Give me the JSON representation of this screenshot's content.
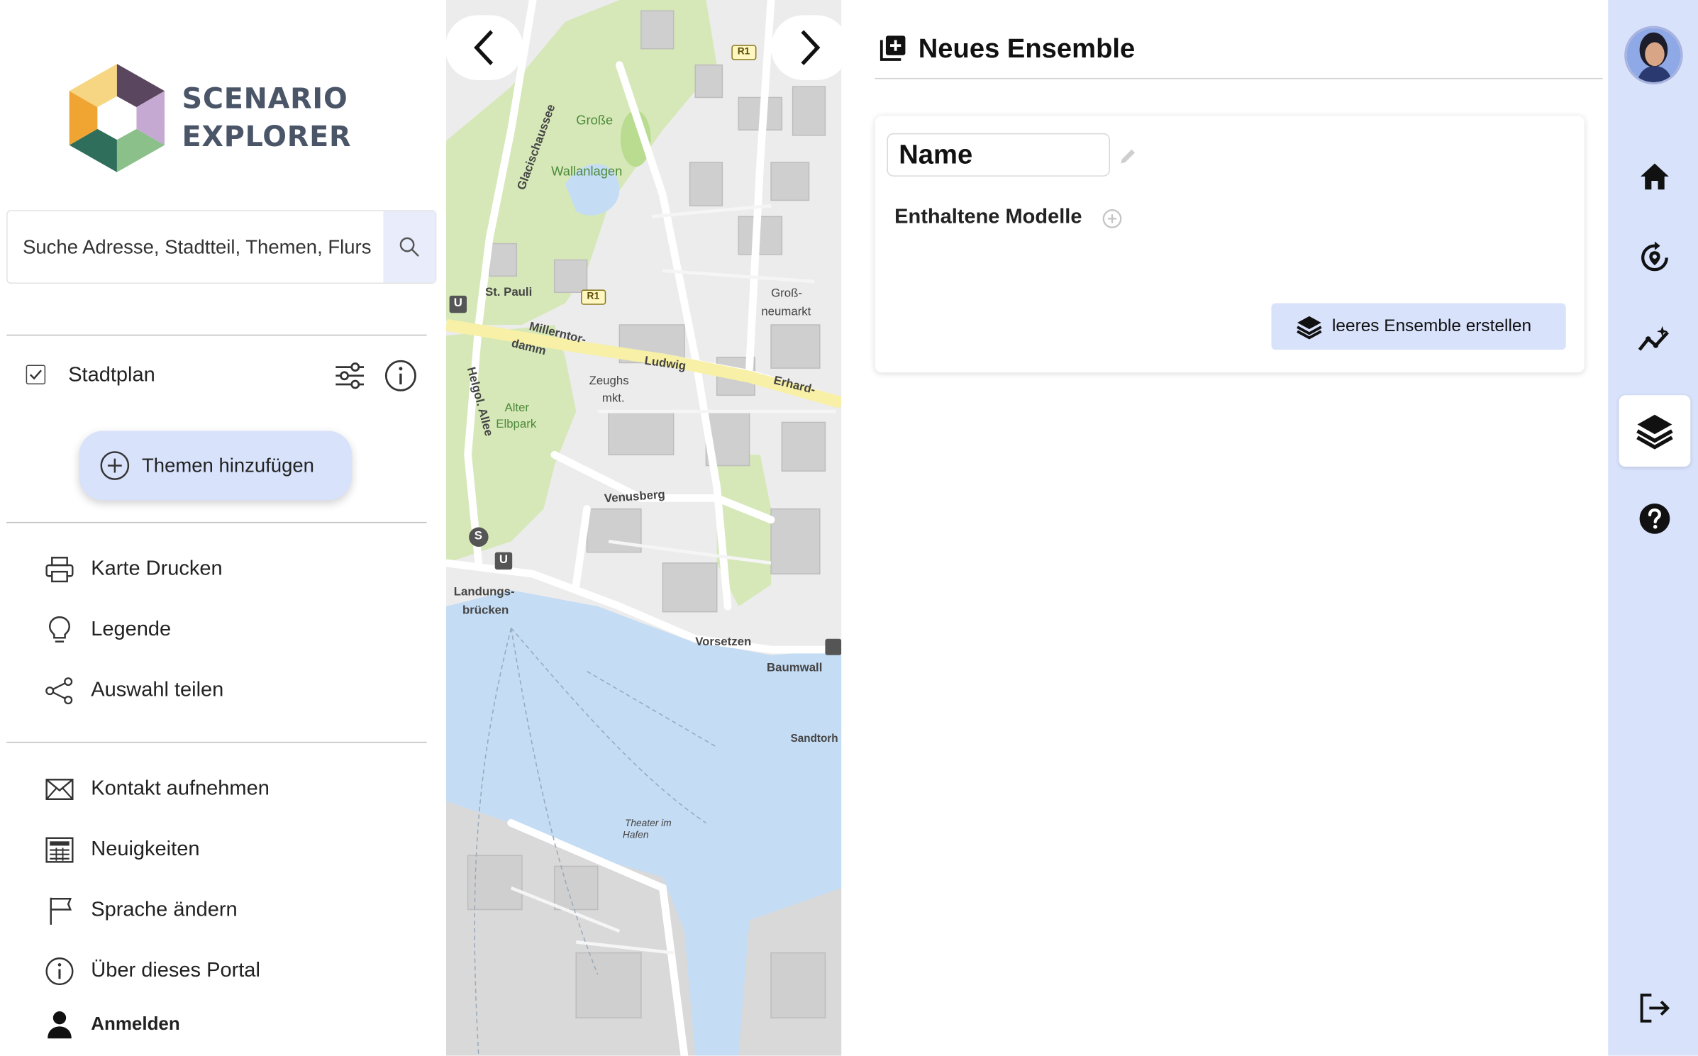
{
  "brand": {
    "line1": "SCENARIO",
    "line2": "EXPLORER"
  },
  "search": {
    "placeholder": "Suche Adresse, Stadtteil, Themen, Flurs"
  },
  "layers": {
    "stadtplan_label": "Stadtplan",
    "stadtplan_checked": true,
    "add_themes_label": "Themen hinzufügen"
  },
  "menu": {
    "print": "Karte Drucken",
    "legend": "Legende",
    "share": "Auswahl teilen",
    "contact": "Kontakt aufnehmen",
    "news": "Neuigkeiten",
    "language": "Sprache ändern",
    "about": "Über dieses Portal",
    "login": "Anmelden"
  },
  "map_labels": {
    "grosse_wallanlagen_1": "Große",
    "grosse_wallanlagen_2": "Wallanlagen",
    "st_pauli": "St. Pauli",
    "millerntor_1": "Millerntor-",
    "millerntor_2": "damm",
    "ludwig": "Ludwig",
    "erhard": "Erhard-",
    "zeughausmarkt_1": "Zeughs",
    "zeughausmarkt_2": "mkt.",
    "alter_elbpark_1": "Alter",
    "alter_elbpark_2": "Elbpark",
    "venusberg": "Venusberg",
    "landungsbruecken_1": "Landungs-",
    "landungsbruecken_2": "brücken",
    "vorsetzen": "Vorsetzen",
    "baumwall": "Baumwall",
    "grossneumarkt_1": "Groß-",
    "grossneumarkt_2": "neumarkt",
    "glacischaussee": "Glacischaussee",
    "helgolaender": "Helgol. Allee",
    "sandtorh": "Sandtorh",
    "theater_1": "Theater im",
    "theater_2": "Hafen",
    "r1": "R1",
    "u": "U",
    "s": "S"
  },
  "panel": {
    "title": "Neues Ensemble",
    "name_value": "Name",
    "models_label": "Enthaltene Modelle",
    "create_button": "leeres Ensemble erstellen"
  },
  "colors": {
    "accent_light": "#d8e2fb",
    "toolbar_bg": "#d8e2fb",
    "text": "#222222",
    "map_water": "#c4dcf4",
    "map_park": "#d6e8b8",
    "map_major_road": "#f7f0a6"
  },
  "icons": {
    "search": "search-icon",
    "home": "home-icon",
    "scenario": "scenario-cycle-icon",
    "analytics": "chart-sparkle-icon",
    "layers": "layers-icon",
    "help": "help-icon",
    "logout": "logout-icon"
  }
}
